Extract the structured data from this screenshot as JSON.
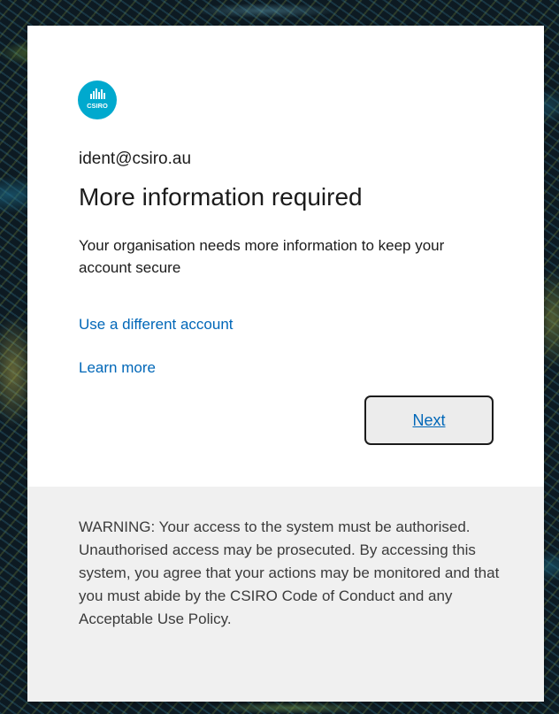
{
  "logo": {
    "text": "CSIRO",
    "color": "#00a9ce"
  },
  "account": {
    "identity": "ident@csiro.au"
  },
  "page": {
    "title": "More information required",
    "description": "Your organisation needs more information to keep your account secure"
  },
  "links": {
    "different_account": "Use a different account",
    "learn_more": "Learn more"
  },
  "actions": {
    "next_label": "Next"
  },
  "footer": {
    "warning": "WARNING: Your access to the system must be authorised. Unauthorised access may be prosecuted. By accessing this system, you agree that your actions may be monitored and that you must abide by the CSIRO Code of Conduct and any Acceptable Use Policy."
  },
  "colors": {
    "link": "#0067b8",
    "text": "#1b1b1b",
    "footer_bg": "#f0f0f0",
    "button_bg": "#ececec"
  }
}
